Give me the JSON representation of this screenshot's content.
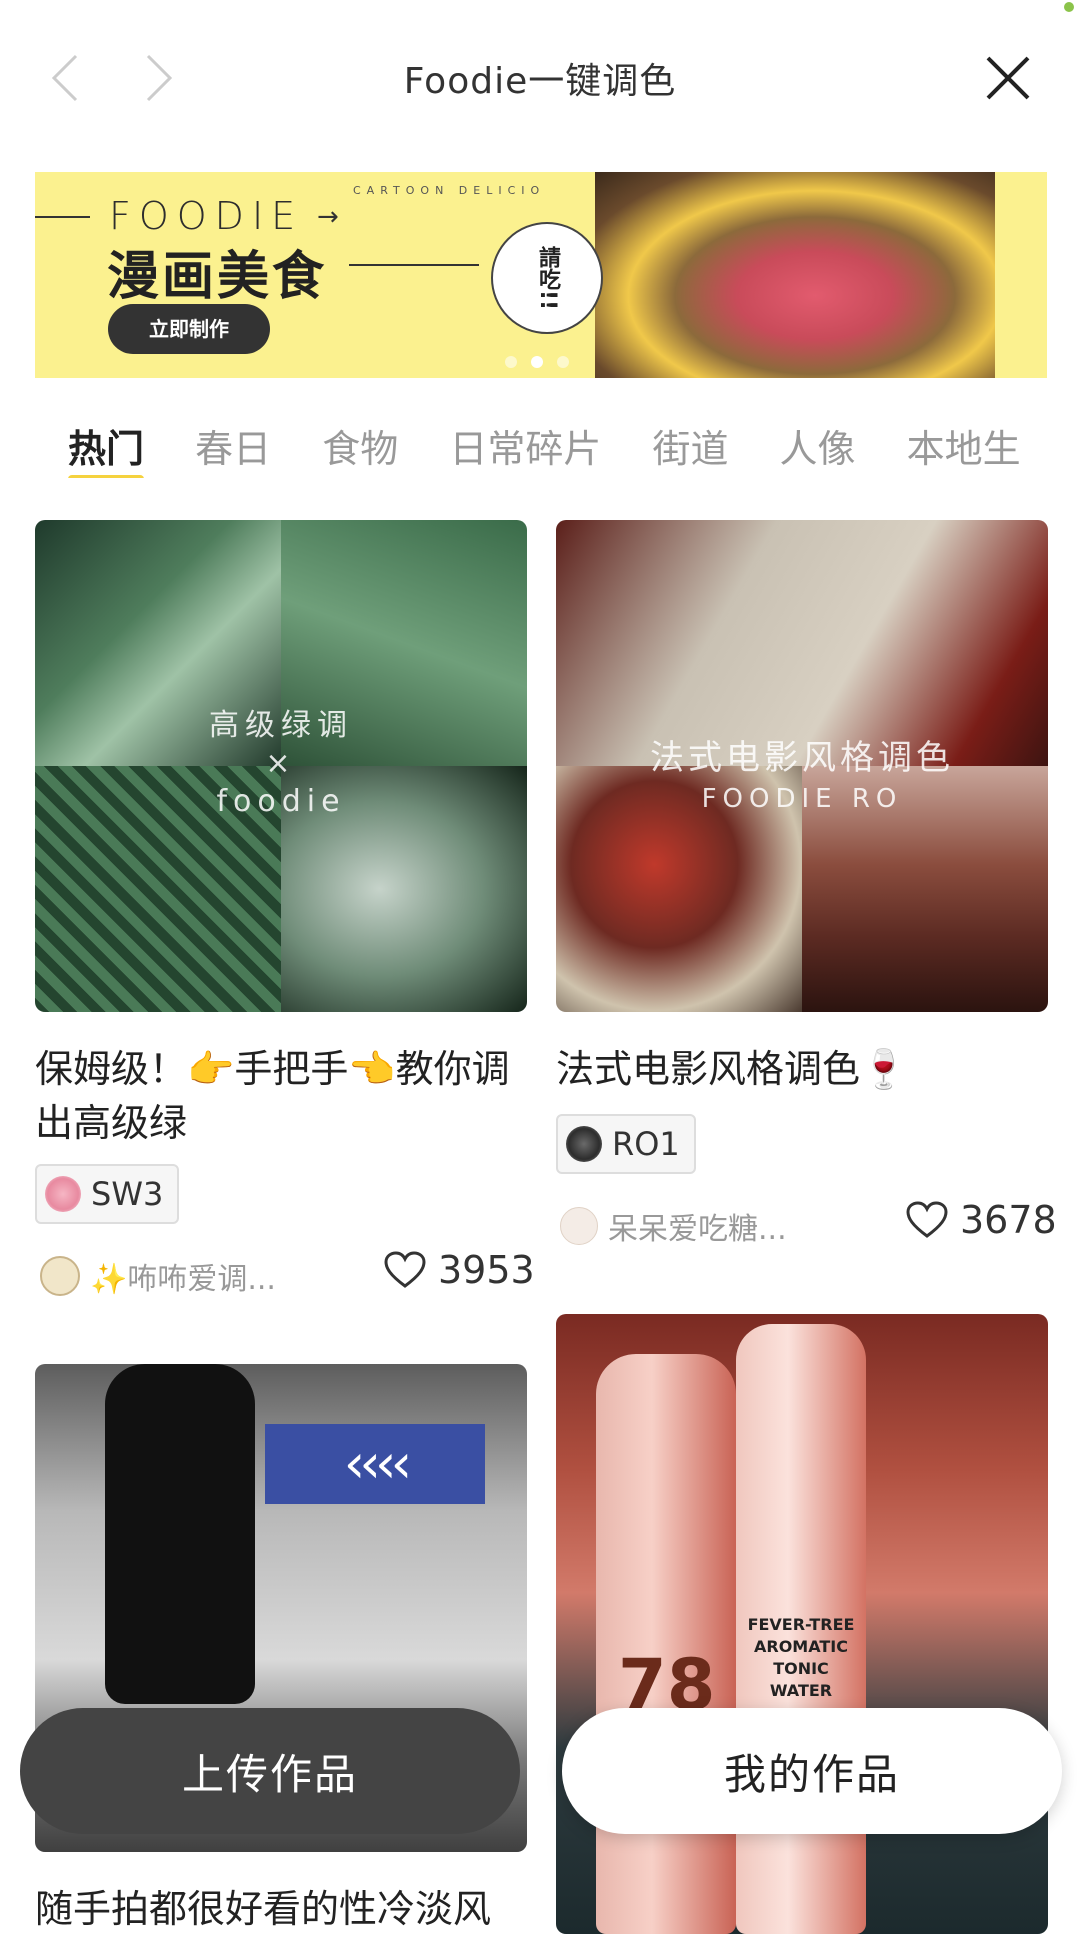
{
  "header": {
    "title": "Foodie一键调色",
    "back_icon": "chevron-left-icon",
    "forward_icon": "chevron-right-icon",
    "close_icon": "close-icon"
  },
  "banner": {
    "brand": "FOODIE",
    "subtext": "CARTOON DELICIO",
    "headline": "漫画美食",
    "cta": "立即制作",
    "bubble": "請吃!!",
    "active_dot": 2,
    "accent": "#fbf18f"
  },
  "tabs": [
    {
      "label": "热门",
      "active": true
    },
    {
      "label": "春日",
      "active": false
    },
    {
      "label": "食物",
      "active": false
    },
    {
      "label": "日常碎片",
      "active": false
    },
    {
      "label": "街道",
      "active": false
    },
    {
      "label": "人像",
      "active": false
    },
    {
      "label": "本地生",
      "active": false
    }
  ],
  "cards": [
    {
      "overlay_top": "高级绿调",
      "overlay_mid": "×",
      "overlay_bottom": "foodie",
      "title": "保姆级！👉手把手👈教你调出高级绿",
      "tag": "SW3",
      "author": "✨咘咘爱调...",
      "likes": "3953"
    },
    {
      "overlay_top": "法式电影风格调色",
      "overlay_bottom": "FOODIE RO",
      "title": "法式电影风格调色🍷",
      "tag": "RO1",
      "author": "呆呆爱吃糖...",
      "likes": "3678"
    },
    {
      "title": "随手拍都很好看的性冷淡风"
    },
    {
      "label_number": "78",
      "label_text": "FEVER-TREE AROMATIC TONIC WATER"
    }
  ],
  "buttons": {
    "upload": "上传作品",
    "mine": "我的作品"
  },
  "accent_color": "#f5d23e"
}
